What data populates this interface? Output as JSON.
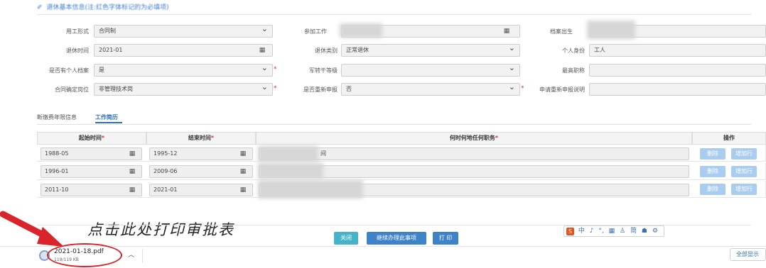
{
  "section": {
    "title": "退休基本信息(注:红色字体标记的为必填项)"
  },
  "form": {
    "row1": {
      "employment_label": "用工形式",
      "employment_value": "合同制",
      "join_work_label": "参加工作",
      "birth_label": "档案出生"
    },
    "row2": {
      "retire_time_label": "退休时间",
      "retire_time_value": "2021-01",
      "retire_type_label": "退休类别",
      "retire_type_value": "正常退休",
      "identity_label": "个人身份",
      "identity_value": "工人"
    },
    "row3": {
      "personal_file_label": "是否有个人档案",
      "personal_file_value": "是",
      "cadre_level_label": "军转干等级",
      "title_label": "最高职称"
    },
    "row4": {
      "contract_post_label": "合同确定岗位",
      "contract_post_value": "非管理技术岗",
      "reapply_label": "是否重新申报",
      "reapply_value": "否",
      "reapply_note_label": "申请重新申报说明"
    }
  },
  "tabs": [
    {
      "label": "断缴费年限信息"
    },
    {
      "label": "工作简历"
    }
  ],
  "table": {
    "headers": {
      "start": "起始时间",
      "end": "结束时间",
      "duty": "何时何地任何职务",
      "req": "*",
      "ops": "操作"
    },
    "rows": [
      {
        "start": "1988-05",
        "end": "1995-12",
        "duty_suffix": "间"
      },
      {
        "start": "1996-01",
        "end": "2009-06",
        "duty_suffix": ""
      },
      {
        "start": "2011-10",
        "end": "2021-01",
        "duty_suffix": ""
      }
    ],
    "delete_label": "删除",
    "add_label": "增加行"
  },
  "annotation": "点击此处打印审批表",
  "buttons": {
    "close": "关闭",
    "continue": "继续办理此事项",
    "print": "打 印"
  },
  "ime": {
    "logo": "S",
    "items": [
      "中",
      "♪",
      "°,",
      "▦",
      "♙",
      "简",
      "☗",
      "⚙"
    ]
  },
  "download": {
    "filename": "2021-01-18.pdf",
    "size": "119/119 KB",
    "show_all": "全部显示"
  },
  "colors": {
    "accent": "#2a6fb3",
    "primary_button": "#47b3c8",
    "secondary_button": "#3e83c8",
    "required": "#e23030",
    "annotation_red": "#d8242a"
  }
}
